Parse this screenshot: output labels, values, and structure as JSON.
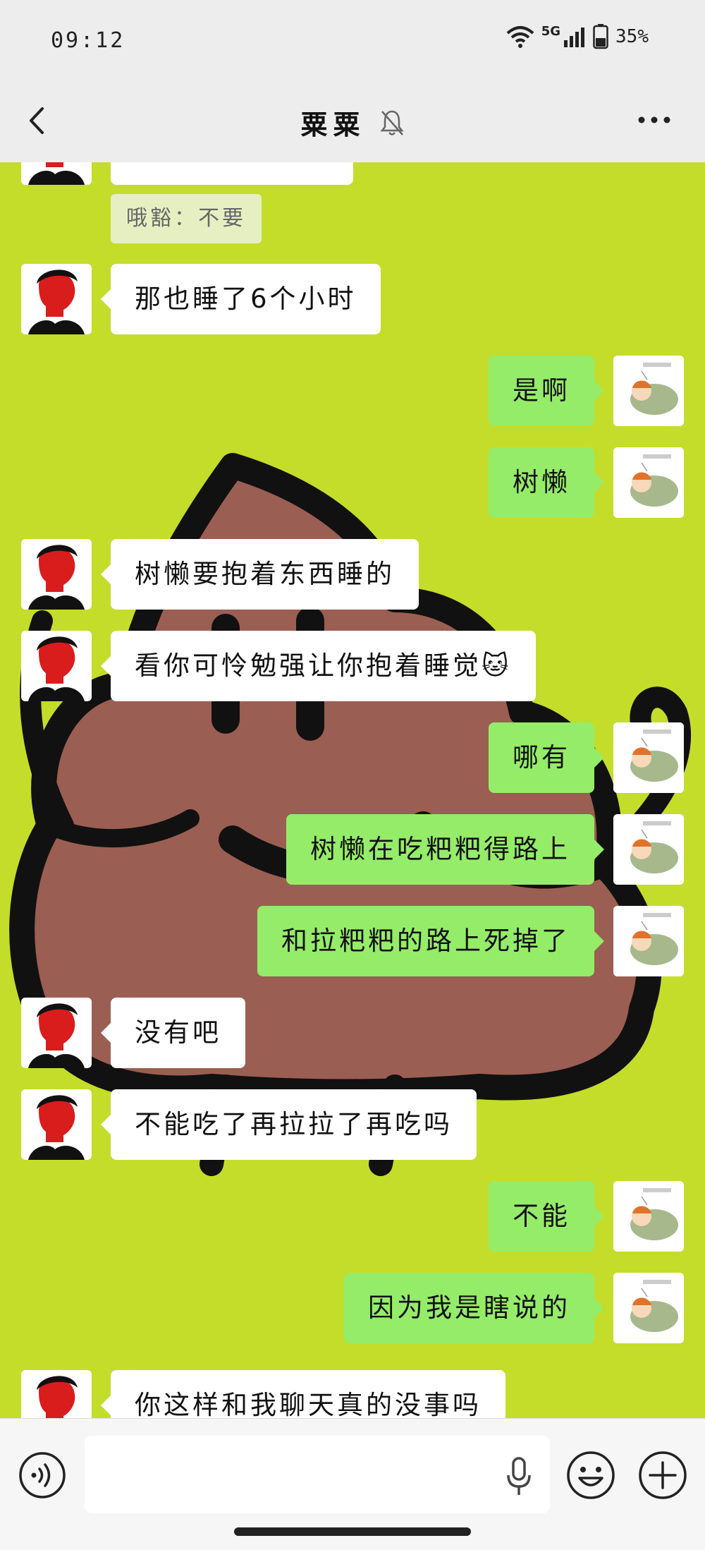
{
  "status_bar": {
    "time": "09:12",
    "network": "5G",
    "battery": "35%"
  },
  "header": {
    "title": "粟粟"
  },
  "chat": {
    "quote_text": "哦豁：不要",
    "messages": [
      {
        "side": "in",
        "text": ""
      },
      {
        "side": "in",
        "text": "那也睡了6个小时"
      },
      {
        "side": "out",
        "text": "是啊"
      },
      {
        "side": "out",
        "text": "树懒"
      },
      {
        "side": "in",
        "text": "树懒要抱着东西睡的"
      },
      {
        "side": "in",
        "text": "看你可怜勉强让你抱着睡觉🐱"
      },
      {
        "side": "out",
        "text": "哪有"
      },
      {
        "side": "out",
        "text": "树懒在吃粑粑得路上"
      },
      {
        "side": "out",
        "text": "和拉粑粑的路上死掉了"
      },
      {
        "side": "in",
        "text": "没有吧"
      },
      {
        "side": "in",
        "text": "不能吃了再拉拉了再吃吗"
      },
      {
        "side": "out",
        "text": "不能"
      },
      {
        "side": "out",
        "text": "因为我是瞎说的"
      },
      {
        "side": "in",
        "text": "你这样和我聊天真的没事吗"
      }
    ]
  },
  "input_bar": {
    "voice_icon": "voice-icon",
    "mic_icon": "mic-icon",
    "emoji_icon": "emoji-icon",
    "plus_icon": "plus-icon"
  },
  "colors": {
    "chat_bg": "#c4dd2a",
    "out_bubble": "#95ec69",
    "in_bubble": "#ffffff",
    "bar_bg": "#ededed"
  }
}
